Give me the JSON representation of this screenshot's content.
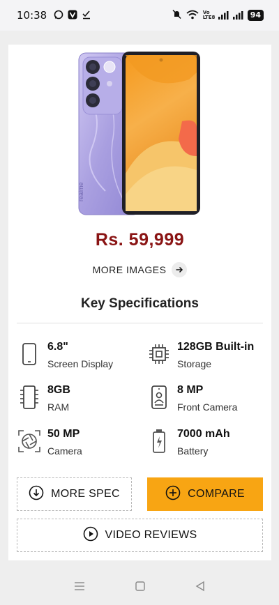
{
  "status_bar": {
    "time": "10:38",
    "battery": "94",
    "network_label": "Vo LTE8"
  },
  "product": {
    "image_name": "realme phone lavender",
    "brand_mark": "realme",
    "price": "Rs. 59,999",
    "more_images_label": "MORE IMAGES"
  },
  "key_specs": {
    "title": "Key Specifications",
    "items": [
      {
        "value": "6.8\"",
        "label": "Screen Display",
        "icon": "screen-icon"
      },
      {
        "value": "128GB Built-in",
        "label": "Storage",
        "icon": "chip-icon"
      },
      {
        "value": "8GB",
        "label": "RAM",
        "icon": "ram-icon"
      },
      {
        "value": "8 MP",
        "label": "Front Camera",
        "icon": "front-camera-icon"
      },
      {
        "value": "50 MP",
        "label": "Camera",
        "icon": "camera-aperture-icon"
      },
      {
        "value": "7000 mAh",
        "label": "Battery",
        "icon": "battery-icon"
      }
    ]
  },
  "buttons": {
    "more_spec": "MORE SPEC",
    "compare": "COMPARE",
    "video_reviews": "VIDEO REVIEWS"
  },
  "colors": {
    "price": "#8a1414",
    "compare_bg": "#f8a513",
    "phone_body": "#a99fe0"
  }
}
